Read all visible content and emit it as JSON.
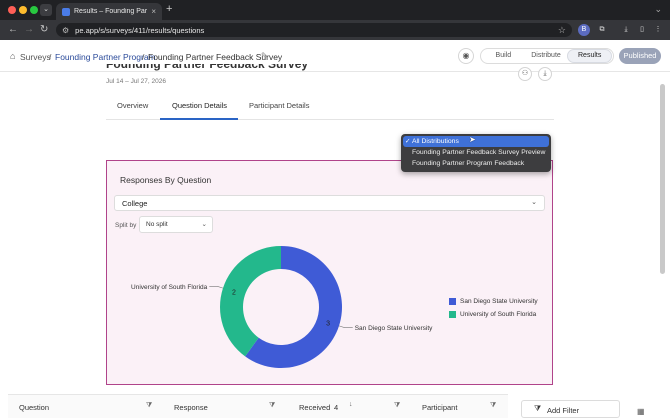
{
  "browser": {
    "tab_title": "Results – Founding Partner Fe",
    "url": "pe.app/s/surveys/411/results/questions",
    "profile_initial": "B"
  },
  "header": {
    "breadcrumbs": [
      {
        "label": "Surveys"
      },
      {
        "label": "Founding Partner Program"
      },
      {
        "label": "Founding Partner Feedback Survey"
      }
    ],
    "separator": "/",
    "modes": [
      {
        "label": "Build",
        "active": false
      },
      {
        "label": "Distribute",
        "active": false
      },
      {
        "label": "Results",
        "active": true
      }
    ],
    "status_button": "Published"
  },
  "survey": {
    "title": "Founding Partner Feedback Survey",
    "date_range": "Jul 14 – Jul 27, 2026"
  },
  "page_tabs": [
    {
      "label": "Overview",
      "active": false
    },
    {
      "label": "Question Details",
      "active": true
    },
    {
      "label": "Participant Details",
      "active": false
    }
  ],
  "distribution_menu": {
    "options": [
      {
        "label": "All Distributions",
        "selected": true
      },
      {
        "label": "Founding Partner Feedback Survey Preview",
        "selected": false
      },
      {
        "label": "Founding Partner Program Feedback",
        "selected": false
      }
    ],
    "check_glyph": "✓"
  },
  "responses_card": {
    "title": "Responses By Question",
    "question_value": "College",
    "split_label": "Split by",
    "split_value": "No split"
  },
  "chart_data": {
    "type": "pie",
    "categories": [
      "San Diego State University",
      "University of South Florida"
    ],
    "values": [
      3,
      2
    ],
    "colors": [
      "#3f5bd6",
      "#23b88c"
    ],
    "donut": true,
    "legend": "right"
  },
  "table_header": {
    "columns": [
      {
        "label": "Question"
      },
      {
        "label": "Response"
      },
      {
        "label": "Received",
        "count": "4"
      },
      {
        "label": "Participant"
      }
    ],
    "add_filter_label": "Add Filter"
  }
}
